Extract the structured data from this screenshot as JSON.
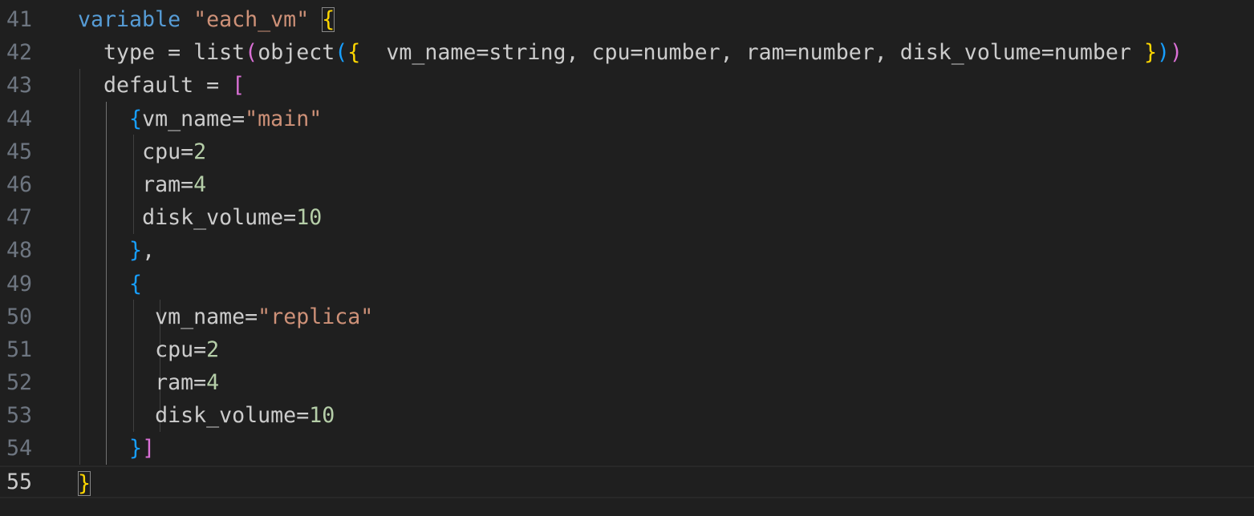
{
  "editor": {
    "line_numbers": [
      "41",
      "42",
      "43",
      "44",
      "45",
      "46",
      "47",
      "48",
      "49",
      "50",
      "51",
      "52",
      "53",
      "54",
      "55"
    ],
    "current_line": "55",
    "lines": {
      "l41": {
        "keyword": "variable",
        "name": "\"each_vm\"",
        "open": "{"
      },
      "l42": {
        "key": "type",
        "eq": " = ",
        "fn1": "list",
        "p1": "(",
        "fn2": "object",
        "p2": "(",
        "brace": "{",
        "body": "  vm_name=string, cpu=number, ram=number, disk_volume=number ",
        "brace_close": "}",
        "p2c": ")",
        "p1c": ")"
      },
      "l43": {
        "key": "default",
        "eq": " = ",
        "open": "["
      },
      "l44": {
        "brace": "{",
        "key": "vm_name=",
        "val": "\"main\""
      },
      "l45": {
        "key": "cpu=",
        "val": "2"
      },
      "l46": {
        "key": "ram=",
        "val": "4"
      },
      "l47": {
        "key": "disk_volume=",
        "val": "10"
      },
      "l48": {
        "brace": "}",
        "rest": ","
      },
      "l49": {
        "brace": "{"
      },
      "l50": {
        "key": "vm_name=",
        "val": "\"replica\""
      },
      "l51": {
        "key": "cpu=",
        "val": "2"
      },
      "l52": {
        "key": "ram=",
        "val": "4"
      },
      "l53": {
        "key": "disk_volume=",
        "val": "10"
      },
      "l54": {
        "brace": "}",
        "bracket": "]"
      },
      "l55": {
        "close": "}"
      }
    }
  },
  "colors": {
    "background": "#1f1f1f",
    "keyword": "#569cd6",
    "string": "#ce9178",
    "number": "#b5cea8",
    "bracket_level1": "#ffd700",
    "bracket_level2": "#da70d6",
    "bracket_level3": "#179fff"
  }
}
